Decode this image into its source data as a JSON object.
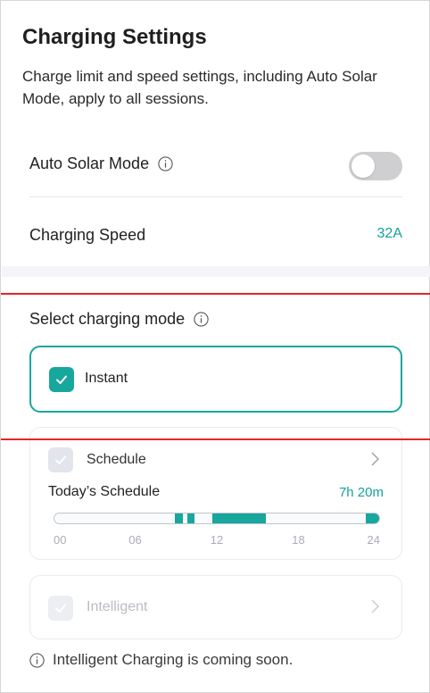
{
  "header": {
    "title": "Charging Settings",
    "subtitle": "Charge limit and speed settings, including Auto Solar Mode, apply to all sessions."
  },
  "settings": {
    "auto_solar": {
      "label": "Auto Solar Mode",
      "enabled": false
    },
    "charging_speed": {
      "label": "Charging Speed",
      "value": "32A"
    }
  },
  "mode_section": {
    "heading": "Select charging mode",
    "modes": [
      {
        "label": "Instant",
        "selected": true,
        "enabled": true
      },
      {
        "label": "Schedule",
        "selected": false,
        "enabled": true
      },
      {
        "label": "Intelligent",
        "selected": false,
        "enabled": false
      }
    ]
  },
  "schedule": {
    "today_label": "Today’s Schedule",
    "total": "7h 20m",
    "axis_min_hour": 0,
    "axis_max_hour": 24,
    "tick_labels": [
      "00",
      "06",
      "12",
      "18",
      "24"
    ],
    "segments": [
      {
        "start_hour": 8.9,
        "end_hour": 9.5
      },
      {
        "start_hour": 9.8,
        "end_hour": 10.35
      },
      {
        "start_hour": 11.7,
        "end_hour": 15.6
      },
      {
        "start_hour": 23.0,
        "end_hour": 24.0
      }
    ]
  },
  "footnote": "Intelligent Charging is coming soon.",
  "colors": {
    "accent": "#17a79d",
    "accent_text": "#12a39a",
    "toggle_off": "#cfcfd2",
    "annotation_line": "#e3262c"
  }
}
